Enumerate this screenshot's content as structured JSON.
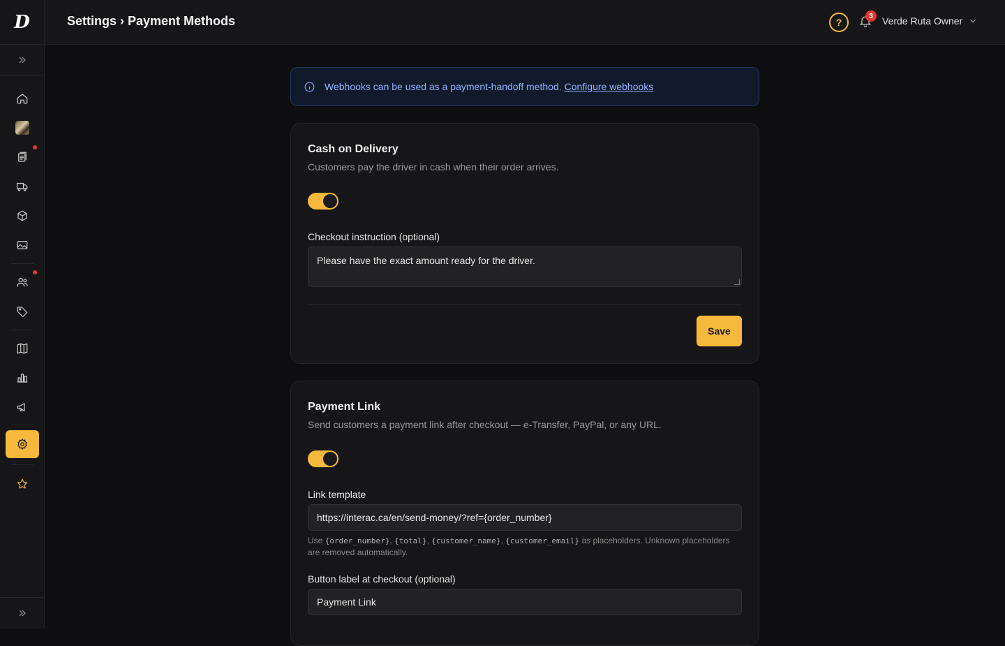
{
  "header": {
    "breadcrumb": "Settings › Payment Methods",
    "help_label": "?",
    "notification_count": "3",
    "user_name": "Verde Ruta Owner"
  },
  "banner": {
    "text": "Webhooks can be used as a payment-handoff method.",
    "link_label": "Configure webhooks"
  },
  "cash_on_delivery": {
    "title": "Cash on Delivery",
    "subtitle": "Customers pay the driver in cash when their order arrives.",
    "enabled": true,
    "instruction_label": "Checkout instruction (optional)",
    "instruction_value": "Please have the exact amount ready for the driver.",
    "save_label": "Save"
  },
  "payment_link": {
    "title": "Payment Link",
    "subtitle": "Send customers a payment link after checkout — e-Transfer, PayPal, or any URL.",
    "enabled": true,
    "template_label": "Link template",
    "template_value": "https://interac.ca/en/send-money/?ref={order_number}",
    "hint_prefix": "Use",
    "placeholders": [
      "{order_number}",
      "{total}",
      "{customer_name}",
      "{customer_email}"
    ],
    "hint_suffix": "as placeholders. Unknown placeholders are removed automatically.",
    "button_label_label": "Button label at checkout (optional)",
    "button_label_value": "Payment Link"
  },
  "colors": {
    "accent": "#f6b93b",
    "background": "#0e0e10",
    "card": "#161618",
    "info": "#8fb4ff",
    "badge": "#e53935"
  },
  "sidebar_icons": [
    "home-icon",
    "store-avatar",
    "orders-icon",
    "delivery-truck-icon",
    "products-box-icon",
    "media-image-icon",
    "customers-users-icon",
    "discount-tag-icon",
    "docs-book-icon",
    "analytics-chart-icon",
    "marketing-megaphone-icon",
    "settings-gear-icon",
    "favorites-star-icon"
  ]
}
